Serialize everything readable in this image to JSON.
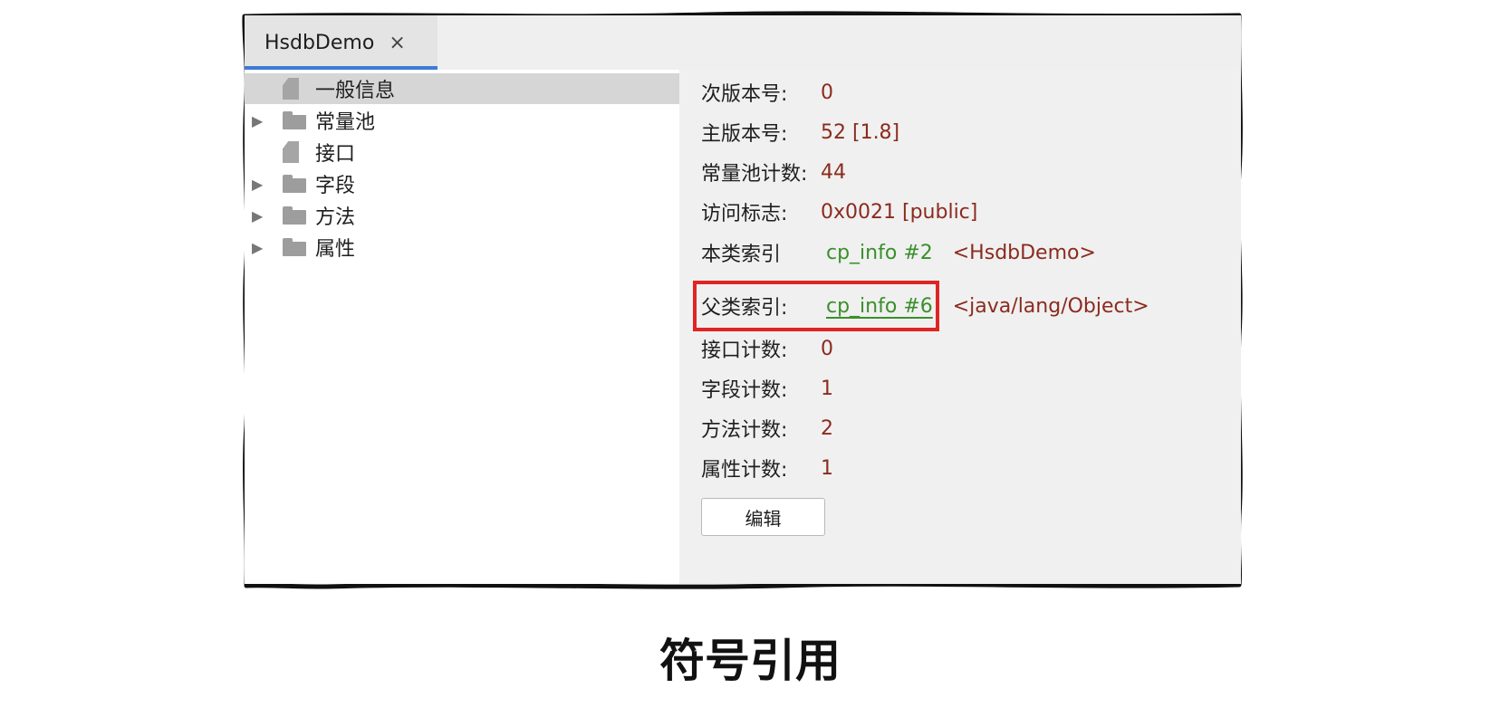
{
  "tab": {
    "title": "HsdbDemo",
    "close": "×"
  },
  "tree": {
    "items": [
      {
        "label": "一般信息",
        "icon": "file-icon",
        "expandable": false,
        "selected": true
      },
      {
        "label": "常量池",
        "icon": "folder-icon",
        "expandable": true,
        "selected": false
      },
      {
        "label": "接口",
        "icon": "file-icon",
        "expandable": false,
        "selected": false
      },
      {
        "label": "字段",
        "icon": "folder-icon",
        "expandable": true,
        "selected": false
      },
      {
        "label": "方法",
        "icon": "folder-icon",
        "expandable": true,
        "selected": false
      },
      {
        "label": "属性",
        "icon": "folder-icon",
        "expandable": true,
        "selected": false
      }
    ]
  },
  "details": {
    "minor": {
      "key": "次版本号:",
      "value": "0"
    },
    "major": {
      "key": "主版本号:",
      "value": "52 [1.8]"
    },
    "cp_count": {
      "key": "常量池计数:",
      "value": "44"
    },
    "access": {
      "key": "访问标志:",
      "value": "0x0021 [public]"
    },
    "this_class": {
      "key": "本类索引",
      "link": "cp_info #2",
      "ref": "<HsdbDemo>"
    },
    "super_class": {
      "key": "父类索引:",
      "link": "cp_info #6",
      "ref": "<java/lang/Object>"
    },
    "iface_count": {
      "key": "接口计数:",
      "value": "0"
    },
    "field_count": {
      "key": "字段计数:",
      "value": "1"
    },
    "method_count": {
      "key": "方法计数:",
      "value": "2"
    },
    "attr_count": {
      "key": "属性计数:",
      "value": "1"
    },
    "edit_label": "编辑"
  },
  "caption": "符号引用",
  "colors": {
    "value": "#8b2b1e",
    "link": "#3a8f2a",
    "highlight": "#e02424",
    "tab_accent": "#3d7bd6"
  }
}
